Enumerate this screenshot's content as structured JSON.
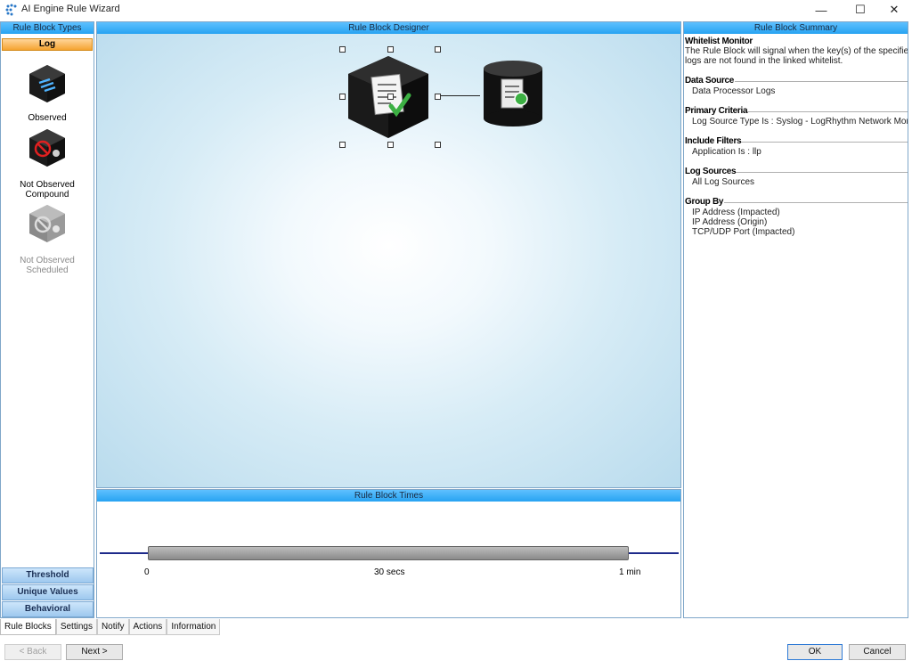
{
  "window": {
    "title": "AI Engine Rule Wizard",
    "minimize": "—",
    "maximize": "☐",
    "close": "✕"
  },
  "left_panel": {
    "header": "Rule Block Types",
    "active_group": "Log",
    "block_types": [
      {
        "label": "Observed",
        "icon": "observed-cube-icon"
      },
      {
        "label": "Not Observed Compound",
        "icon": "not-observed-compound-cube-icon"
      },
      {
        "label": "Not Observed Scheduled",
        "icon": "not-observed-scheduled-cube-icon"
      }
    ],
    "groups": [
      "Threshold",
      "Unique Values",
      "Behavioral"
    ]
  },
  "designer": {
    "header": "Rule Block Designer"
  },
  "times": {
    "header": "Rule Block Times",
    "ticks": [
      "0",
      "30 secs",
      "1 min"
    ]
  },
  "summary": {
    "header": "Rule Block Summary",
    "sections": [
      {
        "title": "Whitelist Monitor",
        "lines": [
          "The Rule Block will signal when the key(s) of the specified",
          "logs are not found in the linked whitelist."
        ]
      },
      {
        "title": "Data Source",
        "lines": [
          "Data Processor Logs"
        ]
      },
      {
        "title": "Primary Criteria",
        "lines": [
          "Log Source Type Is : Syslog - LogRhythm Network Monitor"
        ]
      },
      {
        "title": "Include Filters",
        "lines": [
          "Application Is : llp"
        ]
      },
      {
        "title": "Log Sources",
        "lines": [
          "All Log Sources"
        ]
      },
      {
        "title": "Group By",
        "lines": [
          "IP Address (Impacted)",
          "IP Address (Origin)",
          "TCP/UDP Port (Impacted)"
        ]
      }
    ]
  },
  "tabs": [
    "Rule Blocks",
    "Settings",
    "Notify",
    "Actions",
    "Information"
  ],
  "buttons": {
    "back": "< Back",
    "next": "Next >",
    "ok": "OK",
    "cancel": "Cancel"
  },
  "colors": {
    "header_blue": "#27a3f2",
    "log_tab_orange": "#f5a431",
    "timeline_navy": "#1e2a8a",
    "check_green": "#3cb043"
  }
}
